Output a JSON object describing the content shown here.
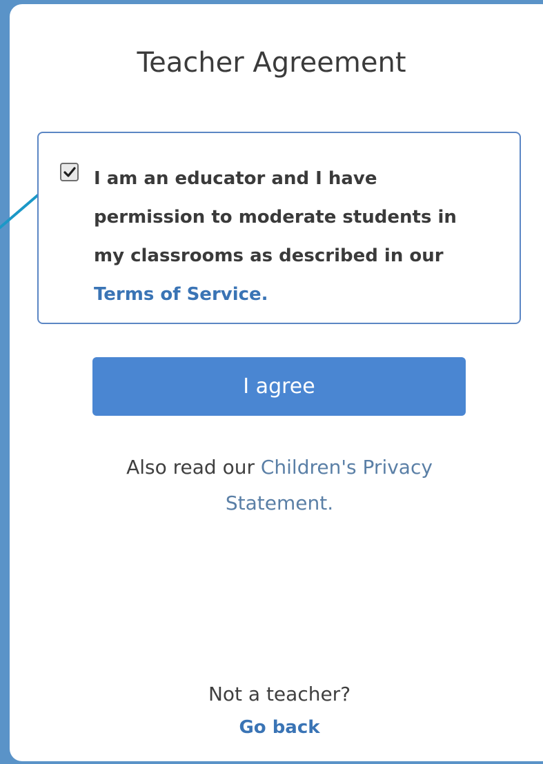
{
  "dialog": {
    "title": "Teacher Agreement",
    "checkbox": {
      "checked": true,
      "line1": "I am an educator and I have",
      "line2": "permission to moderate students in",
      "line3": "my classrooms as described in our",
      "link": "Terms of Service."
    },
    "agree_button": "I agree",
    "privacy": {
      "prefix": "Also read our ",
      "link_part1": "Children's Privacy",
      "link_part2": "Statement."
    },
    "not_teacher": "Not a teacher?",
    "go_back": "Go back"
  },
  "colors": {
    "background": "#5a93c8",
    "accent": "#4a86d2",
    "link": "#3a74b5",
    "annotation_arrow": "#1b98c7"
  },
  "icons": {
    "checkbox": "checkmark-icon",
    "annotation": "arrow-icon"
  }
}
